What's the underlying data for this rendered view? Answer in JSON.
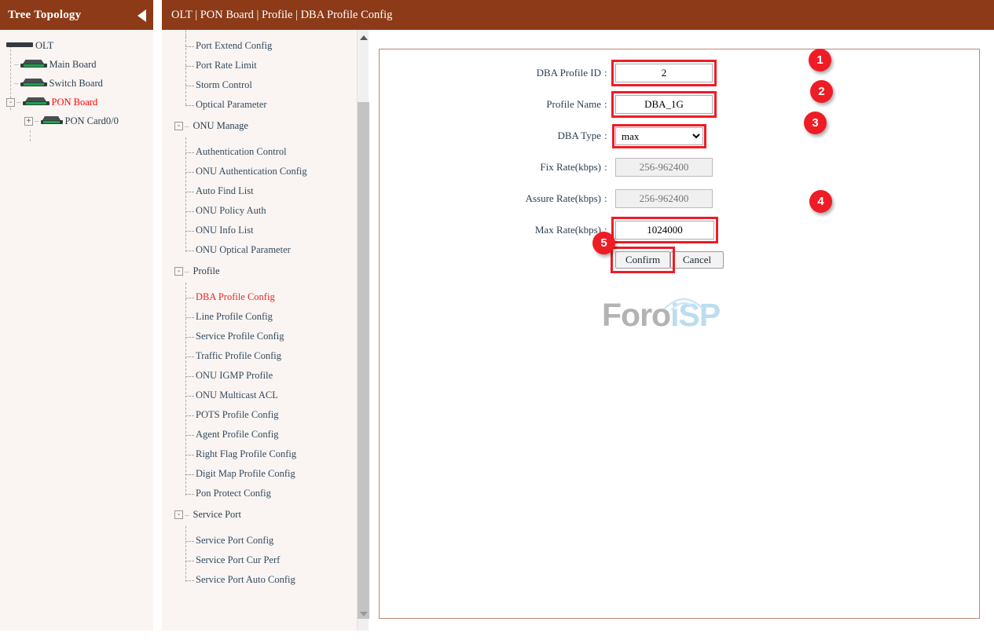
{
  "tree_panel": {
    "title": "Tree Topology",
    "collapse_icon": "caret-left-icon",
    "nodes": [
      {
        "label": "OLT",
        "icon": "device-icon",
        "depth": 0,
        "expander": "",
        "active": false
      },
      {
        "label": "Main Board",
        "icon": "device-icon",
        "depth": 1,
        "expander": "",
        "active": false
      },
      {
        "label": "Switch Board",
        "icon": "device-icon",
        "depth": 1,
        "expander": "",
        "active": false
      },
      {
        "label": "PON Board",
        "icon": "device-icon",
        "depth": 1,
        "expander": "-",
        "active": true
      },
      {
        "label": "PON Card0/0",
        "icon": "device-icon",
        "depth": 2,
        "expander": "+",
        "active": false
      }
    ]
  },
  "breadcrumb": "OLT | PON Board | Profile | DBA Profile Config",
  "nav": {
    "scrollbar": {
      "up_icon": "caret-up-icon",
      "down_icon": "caret-down-icon"
    },
    "groups": [
      {
        "label": "",
        "expander": "",
        "items": [
          "Port Extend Config",
          "Port Rate Limit",
          "Storm Control",
          "Optical Parameter"
        ]
      },
      {
        "label": "ONU Manage",
        "expander": "-",
        "items": [
          "Authentication Control",
          "ONU Authentication Config",
          "Auto Find List",
          "ONU Policy Auth",
          "ONU Info List",
          "ONU Optical Parameter"
        ]
      },
      {
        "label": "Profile",
        "expander": "-",
        "items": [
          "DBA Profile Config",
          "Line Profile Config",
          "Service Profile Config",
          "Traffic Profile Config",
          "ONU IGMP Profile",
          "ONU Multicast ACL",
          "POTS Profile Config",
          "Agent Profile Config",
          "Right Flag Profile Config",
          "Digit Map Profile Config",
          "Pon Protect Config"
        ]
      },
      {
        "label": "Service Port",
        "expander": "-",
        "items": [
          "Service Port Config",
          "Service Port Cur Perf",
          "Service Port Auto Config"
        ]
      }
    ],
    "active_item": "DBA Profile Config"
  },
  "watermark": {
    "part_a": "Foro",
    "part_b": "iSP"
  },
  "form": {
    "fields": [
      {
        "label": "DBA Profile ID",
        "type": "text",
        "value": "2",
        "placeholder": "",
        "disabled": false,
        "highlight": true,
        "badge": "1"
      },
      {
        "label": "Profile Name",
        "type": "text",
        "value": "DBA_1G",
        "placeholder": "",
        "disabled": false,
        "highlight": true,
        "badge": "2"
      },
      {
        "label": "DBA Type",
        "type": "select",
        "value": "max",
        "options": [
          "max"
        ],
        "disabled": false,
        "highlight": true,
        "badge": "3"
      },
      {
        "label": "Fix Rate(kbps)",
        "type": "text",
        "value": "",
        "placeholder": "256-962400",
        "disabled": true,
        "highlight": false,
        "badge": ""
      },
      {
        "label": "Assure Rate(kbps)",
        "type": "text",
        "value": "",
        "placeholder": "256-962400",
        "disabled": true,
        "highlight": false,
        "badge": ""
      },
      {
        "label": "Max Rate(kbps)",
        "type": "text",
        "value": "1024000",
        "placeholder": "",
        "disabled": false,
        "highlight": true,
        "badge": "4"
      }
    ],
    "confirm_label": "Confirm",
    "cancel_label": "Cancel",
    "confirm_badge": "5"
  },
  "colors": {
    "header_brown": "#8c3a18",
    "panel_bg": "#faf5f2",
    "accent_red": "#ee1c25",
    "active_link": "#e8262a",
    "panel_border": "#b58872"
  }
}
